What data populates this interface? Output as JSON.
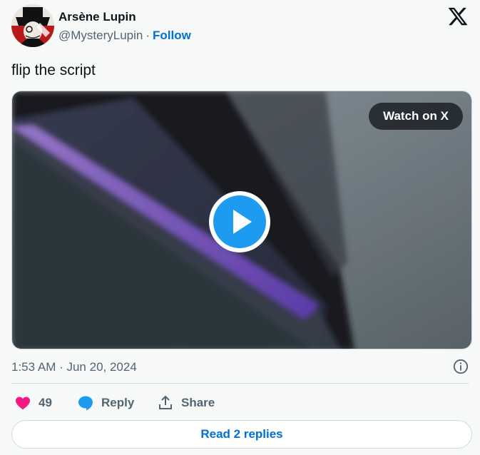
{
  "author": {
    "display_name": "Arsène Lupin",
    "handle": "@MysteryLupin",
    "separator": "·",
    "follow_label": "Follow"
  },
  "tweet": {
    "text": "flip the script"
  },
  "media": {
    "watch_label": "Watch on X",
    "play_icon": "play-icon"
  },
  "meta": {
    "timestamp": "1:53 AM · Jun 20, 2024",
    "info_icon": "info-icon"
  },
  "actions": {
    "like_count": "49",
    "reply_label": "Reply",
    "share_label": "Share"
  },
  "footer": {
    "read_replies_label": "Read 2 replies"
  },
  "colors": {
    "like": "#f91880",
    "reply_icon": "#1d9bf0",
    "link": "#006fd6",
    "play_button": "#1d9bf0",
    "secondary_text": "#536471"
  }
}
